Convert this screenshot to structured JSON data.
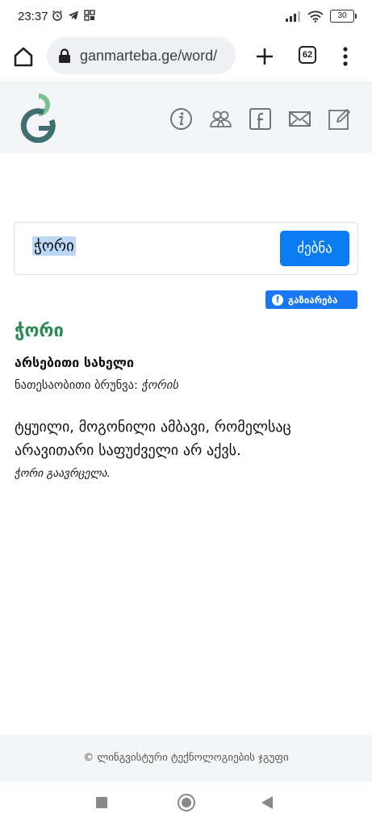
{
  "status_bar": {
    "time": "23:37",
    "battery": "30"
  },
  "browser": {
    "url": "ganmarteba.ge/word/",
    "tab_count": "62"
  },
  "site": {
    "nav_icons": [
      "info-icon",
      "users-icon",
      "facebook-icon",
      "mail-icon",
      "edit-icon"
    ]
  },
  "search": {
    "query": "ჭორი",
    "button_label": "ძებნა"
  },
  "share": {
    "label": "გაზიარება"
  },
  "entry": {
    "headword": "ჭორი",
    "part_of_speech": "არსებითი სახელი",
    "genitive_label": "ნათესაობითი ბრუნვა:",
    "genitive_form": "ჭორის",
    "definition": "ტყუილი, მოგონილი ამბავი, რომელსაც არავითარი საფუძველი არ აქვს.",
    "example": "ჭორი გაავრცელა."
  },
  "footer": {
    "text": "© ლინგვისტური ტექნოლოგიების ჯგუფი"
  },
  "colors": {
    "headword": "#2e8b57",
    "search_button": "#0a7bf1",
    "share_button": "#1877f2",
    "header_bg": "#f4f5f6"
  }
}
